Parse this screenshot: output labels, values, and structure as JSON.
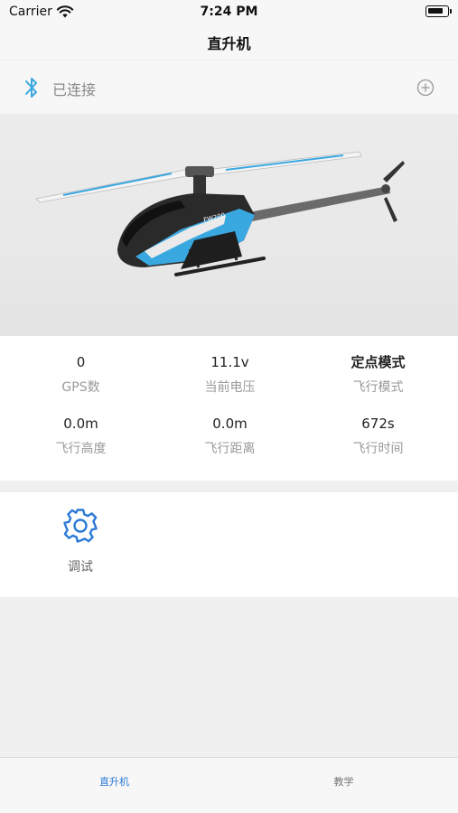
{
  "status_bar": {
    "carrier": "Carrier",
    "time": "7:24 PM"
  },
  "nav": {
    "title": "直升机"
  },
  "bluetooth": {
    "status": "已连接"
  },
  "helicopter": {
    "brand_text": "FW200"
  },
  "stats": [
    {
      "value": "0",
      "label": "GPS数"
    },
    {
      "value": "11.1v",
      "label": "当前电压"
    },
    {
      "value": "定点模式",
      "label": "飞行模式"
    },
    {
      "value": "0.0m",
      "label": "飞行高度"
    },
    {
      "value": "0.0m",
      "label": "飞行距离"
    },
    {
      "value": "672s",
      "label": "飞行时间"
    }
  ],
  "tools": [
    {
      "label": "调试",
      "icon": "gear-icon"
    }
  ],
  "tabs": [
    {
      "label": "直升机",
      "active": true
    },
    {
      "label": "教学",
      "active": false
    }
  ],
  "colors": {
    "accent": "#2b7ad6",
    "heli_blue": "#3aa8e0"
  }
}
